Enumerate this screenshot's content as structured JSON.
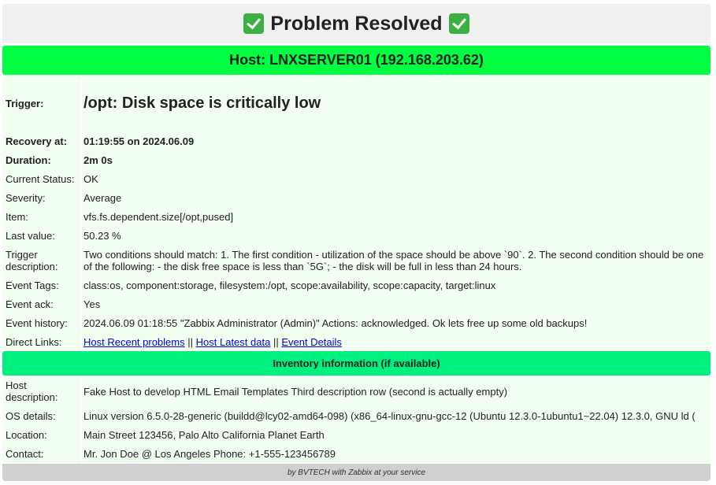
{
  "header": {
    "title": "Problem Resolved",
    "host_line": "Host: LNXSERVER01 (192.168.203.62)"
  },
  "details": {
    "trigger": {
      "label": "Trigger:",
      "value": "/opt: Disk space is critically low"
    },
    "recovery": {
      "label": "Recovery at:",
      "value": "01:19:55 on 2024.06.09"
    },
    "duration": {
      "label": "Duration:",
      "value": "2m 0s"
    },
    "status": {
      "label": "Current Status:",
      "value": "OK"
    },
    "severity": {
      "label": "Severity:",
      "value": "Average"
    },
    "item": {
      "label": "Item:",
      "value": "vfs.fs.dependent.size[/opt,pused]"
    },
    "last_value": {
      "label": "Last value:",
      "value": "50.23 %"
    },
    "trigger_desc": {
      "label": "Trigger description:",
      "value": "Two conditions should match: 1. The first condition - utilization of the space should be above `90`. 2. The second condition should be one of the following: - the disk free space is less than `5G`; - the disk will be full in less than 24 hours."
    },
    "tags": {
      "label": "Event Tags:",
      "value": "class:os, component:storage, filesystem:/opt, scope:availability, scope:capacity, target:linux"
    },
    "ack": {
      "label": "Event ack:",
      "value": "Yes"
    },
    "history": {
      "label": "Event history:",
      "value": "2024.06.09 01:18:55 \"Zabbix Administrator (Admin)\" Actions: acknowledged. Ok lets free up some old backups!"
    },
    "links": {
      "label": "Direct Links:",
      "recent": "Host Recent problems",
      "sep": "||",
      "latest": "Host Latest data",
      "event": "Event Details"
    }
  },
  "inventory": {
    "title": "Inventory information (if available)",
    "host_desc": {
      "label": "Host description:",
      "value": "Fake Host to develop HTML Email Templates Third description row (second is actually empty)"
    },
    "os": {
      "label": "OS details:",
      "value": "Linux version 6.5.0-28-generic (buildd@lcy02-amd64-098) (x86_64-linux-gnu-gcc-12 (Ubuntu 12.3.0-1ubuntu1~22.04) 12.3.0, GNU ld ("
    },
    "location": {
      "label": "Location:",
      "value": "Main Street 123456, Palo Alto California Planet Earth"
    },
    "contact": {
      "label": "Contact:",
      "value": "Mr. Jon Doe @ Los Angeles Phone: +1-555-123456789"
    }
  },
  "footer": {
    "text": "by BVTECH with Zabbix at your service"
  },
  "colors": {
    "host_bar": "#00ff40",
    "inventory_bar": "#00f080",
    "section_bg": "#f0fff0",
    "footer_bg": "#d0d0d0"
  }
}
